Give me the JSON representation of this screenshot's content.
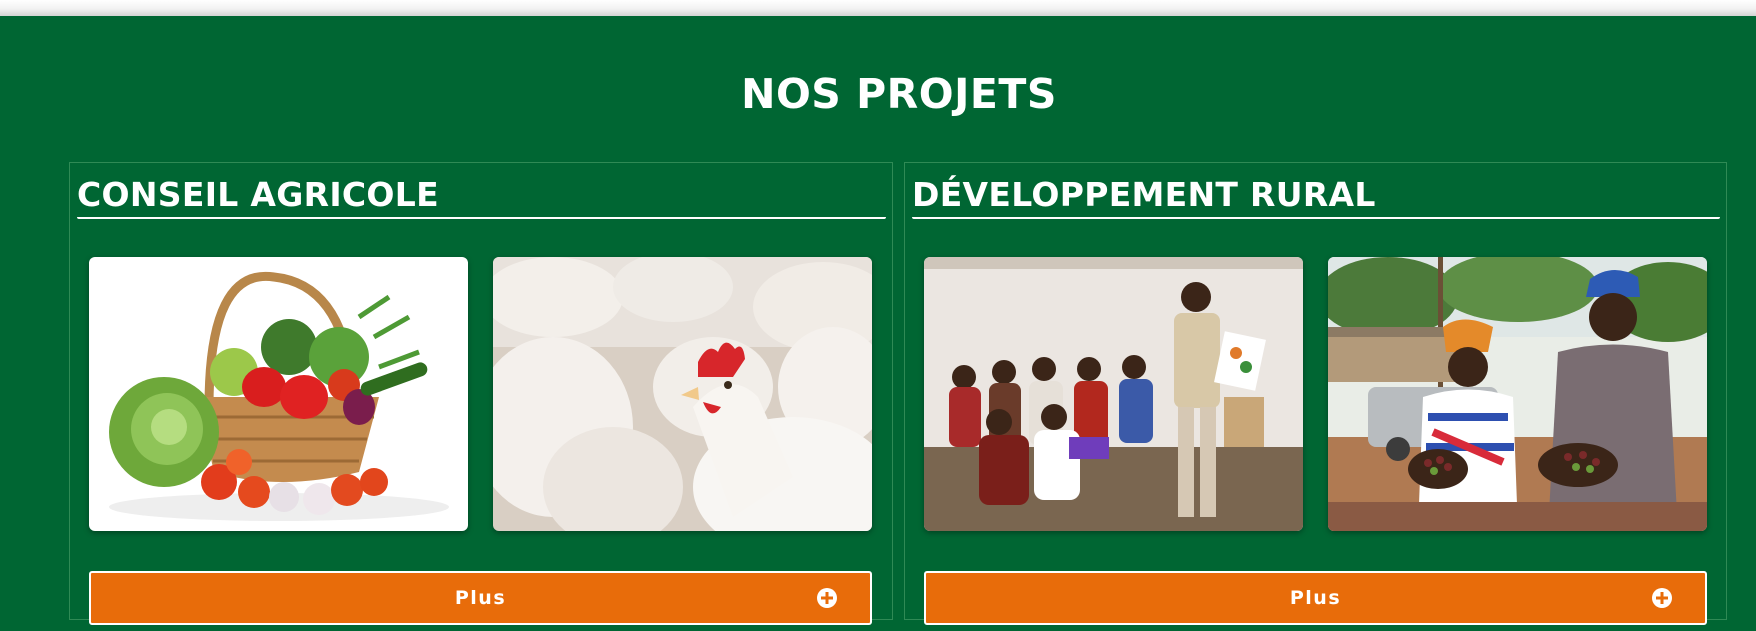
{
  "section": {
    "title": "NOS PROJETS",
    "background_color": "#006633",
    "accent_color": "#e86c0a"
  },
  "projects": [
    {
      "title": "CONSEIL AGRICOLE",
      "images": [
        {
          "subject": "vegetable-basket"
        },
        {
          "subject": "white-chickens"
        }
      ],
      "button_label": "Plus",
      "button_icon": "plus-circle-icon"
    },
    {
      "title": "DÉVELOPPEMENT RURAL",
      "images": [
        {
          "subject": "community-meeting"
        },
        {
          "subject": "farmers-with-coffee-cherries"
        }
      ],
      "button_label": "Plus",
      "button_icon": "plus-circle-icon"
    }
  ]
}
